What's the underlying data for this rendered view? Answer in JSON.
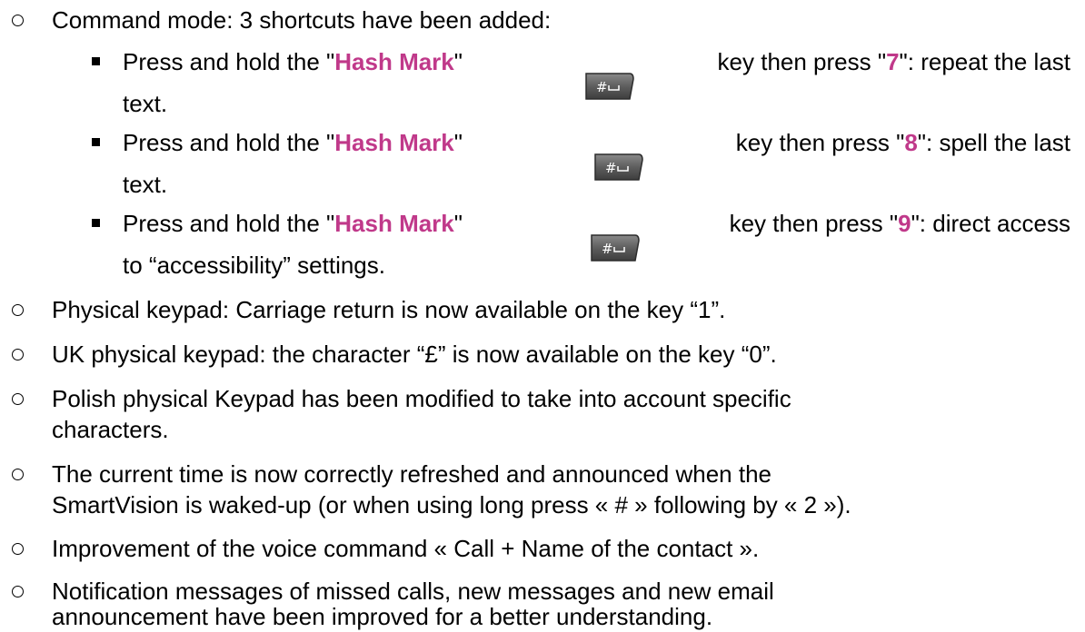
{
  "items": {
    "command_mode": "Command mode: 3 shortcuts have been added:",
    "shortcut_prefix": "Press and hold the \"",
    "hash_mark": "Hash Mark",
    "quote_close": "\"",
    "key_then": "key then press \"",
    "key7": "7",
    "s7_rest": "\": repeat the last",
    "s7_cont": "text.",
    "key8": "8",
    "s8_rest": "\": spell the last",
    "s8_cont": "text.",
    "key9": "9",
    "s9_rest": "\": direct access",
    "s9_cont": "to “accessibility” settings.",
    "physical_keypad": "Physical keypad: Carriage return is now available on the key “1”.",
    "uk_keypad": "UK physical keypad: the character “£” is now available on the key “0”.",
    "polish_1": "Polish physical Keypad has been modified to take into account specific",
    "polish_2": "characters.",
    "time_1": "The current time is now correctly refreshed and announced when the",
    "time_2": "SmartVision is waked-up (or when using long press « # » following by « 2 »).",
    "voice_cmd": "Improvement of the voice command « Call + Name of the contact ».",
    "notif_1": "Notification messages of missed calls, new messages and new email",
    "notif_2": "announcement have been improved for a better understanding."
  },
  "key_icon": {
    "name": "hash-key-icon",
    "glyph": "#␣",
    "bg_color": "#6e6e6e",
    "text_color": "#ffffff"
  },
  "colors": {
    "highlight": "#c0398a",
    "text": "#000000"
  }
}
